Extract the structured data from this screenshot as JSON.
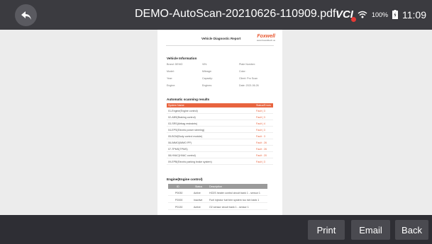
{
  "header": {
    "title": "DEMO-AutoScan-20210626-110909.pdf",
    "vci_label": "VCI",
    "battery_percent": "100%",
    "time": "11:09"
  },
  "report": {
    "title": "Vehicle Diagnostic Report",
    "brand": "Foxwell",
    "brand_url": "www.foxwelltech.us",
    "vehicle_info_heading": "Vehicle Information",
    "vehicle_info": [
      [
        "Brand: DEMO",
        "VIN:",
        "Plate Number:"
      ],
      [
        "Model:",
        "Mileage:",
        "Color:"
      ],
      [
        "Year:",
        "Capacity:",
        "Client: Pro Scan"
      ],
      [
        "Engine:",
        "Engines:",
        "Date: 2021.06.26"
      ]
    ],
    "scan_heading": "Automatic scanning results",
    "scan_columns": [
      "System Name",
      "Status/Errors"
    ],
    "scan_rows": [
      [
        "01-Engine(Engine control)",
        "Fault | 3"
      ],
      [
        "02-ABS(Braking control)",
        "Fault | 3"
      ],
      [
        "03-SRS(Airbag restraints)",
        "Fault | 4"
      ],
      [
        "04-EPS(Electric power steering)",
        "Fault | 3"
      ],
      [
        "05-BCM(Body control module)",
        "Fault : 3"
      ],
      [
        "06-IMMO(IMMO PP)",
        "Fault : 26"
      ],
      [
        "07-TPMS(TPMS)",
        "Fault : 26"
      ],
      [
        "08-HVAC(HVAC control)",
        "Fault : 20"
      ],
      [
        "09-EPB(Electric parking brake system)",
        "Fault | 3"
      ]
    ],
    "engine_heading": "Engine(Engine control)",
    "engine_columns": [
      "ID",
      "Status",
      "Description"
    ],
    "engine_rows": [
      [
        "P0030",
        "Active",
        "HO2S heater control circuit bank 1 - sensor 1"
      ],
      [
        "P2000",
        "Inactive",
        "Fuel injector fuel trim system too rich bank 1"
      ],
      [
        "P0130",
        "Active",
        "O2 sensor circuit bank 1 - sensor 1"
      ]
    ]
  },
  "buttons": {
    "print": "Print",
    "email": "Email",
    "back": "Back"
  }
}
